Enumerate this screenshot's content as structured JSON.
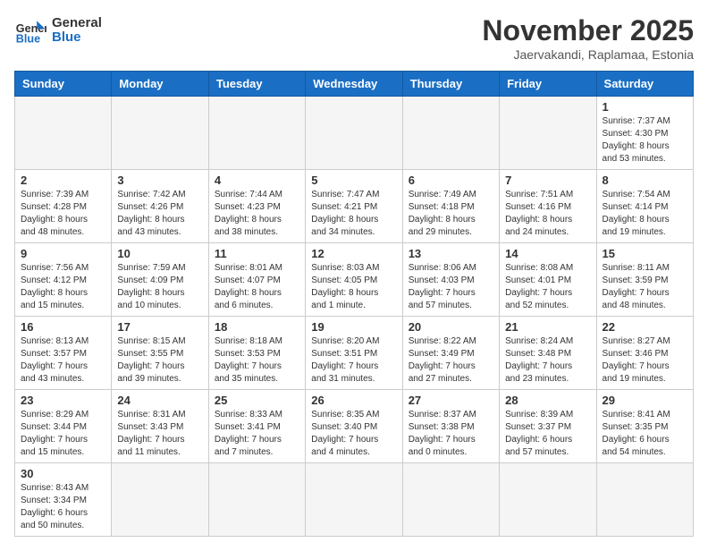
{
  "header": {
    "logo_general": "General",
    "logo_blue": "Blue",
    "month_title": "November 2025",
    "location": "Jaervakandi, Raplamaa, Estonia"
  },
  "days_of_week": [
    "Sunday",
    "Monday",
    "Tuesday",
    "Wednesday",
    "Thursday",
    "Friday",
    "Saturday"
  ],
  "weeks": [
    [
      {
        "day": "",
        "info": ""
      },
      {
        "day": "",
        "info": ""
      },
      {
        "day": "",
        "info": ""
      },
      {
        "day": "",
        "info": ""
      },
      {
        "day": "",
        "info": ""
      },
      {
        "day": "",
        "info": ""
      },
      {
        "day": "1",
        "info": "Sunrise: 7:37 AM\nSunset: 4:30 PM\nDaylight: 8 hours\nand 53 minutes."
      }
    ],
    [
      {
        "day": "2",
        "info": "Sunrise: 7:39 AM\nSunset: 4:28 PM\nDaylight: 8 hours\nand 48 minutes."
      },
      {
        "day": "3",
        "info": "Sunrise: 7:42 AM\nSunset: 4:26 PM\nDaylight: 8 hours\nand 43 minutes."
      },
      {
        "day": "4",
        "info": "Sunrise: 7:44 AM\nSunset: 4:23 PM\nDaylight: 8 hours\nand 38 minutes."
      },
      {
        "day": "5",
        "info": "Sunrise: 7:47 AM\nSunset: 4:21 PM\nDaylight: 8 hours\nand 34 minutes."
      },
      {
        "day": "6",
        "info": "Sunrise: 7:49 AM\nSunset: 4:18 PM\nDaylight: 8 hours\nand 29 minutes."
      },
      {
        "day": "7",
        "info": "Sunrise: 7:51 AM\nSunset: 4:16 PM\nDaylight: 8 hours\nand 24 minutes."
      },
      {
        "day": "8",
        "info": "Sunrise: 7:54 AM\nSunset: 4:14 PM\nDaylight: 8 hours\nand 19 minutes."
      }
    ],
    [
      {
        "day": "9",
        "info": "Sunrise: 7:56 AM\nSunset: 4:12 PM\nDaylight: 8 hours\nand 15 minutes."
      },
      {
        "day": "10",
        "info": "Sunrise: 7:59 AM\nSunset: 4:09 PM\nDaylight: 8 hours\nand 10 minutes."
      },
      {
        "day": "11",
        "info": "Sunrise: 8:01 AM\nSunset: 4:07 PM\nDaylight: 8 hours\nand 6 minutes."
      },
      {
        "day": "12",
        "info": "Sunrise: 8:03 AM\nSunset: 4:05 PM\nDaylight: 8 hours\nand 1 minute."
      },
      {
        "day": "13",
        "info": "Sunrise: 8:06 AM\nSunset: 4:03 PM\nDaylight: 7 hours\nand 57 minutes."
      },
      {
        "day": "14",
        "info": "Sunrise: 8:08 AM\nSunset: 4:01 PM\nDaylight: 7 hours\nand 52 minutes."
      },
      {
        "day": "15",
        "info": "Sunrise: 8:11 AM\nSunset: 3:59 PM\nDaylight: 7 hours\nand 48 minutes."
      }
    ],
    [
      {
        "day": "16",
        "info": "Sunrise: 8:13 AM\nSunset: 3:57 PM\nDaylight: 7 hours\nand 43 minutes."
      },
      {
        "day": "17",
        "info": "Sunrise: 8:15 AM\nSunset: 3:55 PM\nDaylight: 7 hours\nand 39 minutes."
      },
      {
        "day": "18",
        "info": "Sunrise: 8:18 AM\nSunset: 3:53 PM\nDaylight: 7 hours\nand 35 minutes."
      },
      {
        "day": "19",
        "info": "Sunrise: 8:20 AM\nSunset: 3:51 PM\nDaylight: 7 hours\nand 31 minutes."
      },
      {
        "day": "20",
        "info": "Sunrise: 8:22 AM\nSunset: 3:49 PM\nDaylight: 7 hours\nand 27 minutes."
      },
      {
        "day": "21",
        "info": "Sunrise: 8:24 AM\nSunset: 3:48 PM\nDaylight: 7 hours\nand 23 minutes."
      },
      {
        "day": "22",
        "info": "Sunrise: 8:27 AM\nSunset: 3:46 PM\nDaylight: 7 hours\nand 19 minutes."
      }
    ],
    [
      {
        "day": "23",
        "info": "Sunrise: 8:29 AM\nSunset: 3:44 PM\nDaylight: 7 hours\nand 15 minutes."
      },
      {
        "day": "24",
        "info": "Sunrise: 8:31 AM\nSunset: 3:43 PM\nDaylight: 7 hours\nand 11 minutes."
      },
      {
        "day": "25",
        "info": "Sunrise: 8:33 AM\nSunset: 3:41 PM\nDaylight: 7 hours\nand 7 minutes."
      },
      {
        "day": "26",
        "info": "Sunrise: 8:35 AM\nSunset: 3:40 PM\nDaylight: 7 hours\nand 4 minutes."
      },
      {
        "day": "27",
        "info": "Sunrise: 8:37 AM\nSunset: 3:38 PM\nDaylight: 7 hours\nand 0 minutes."
      },
      {
        "day": "28",
        "info": "Sunrise: 8:39 AM\nSunset: 3:37 PM\nDaylight: 6 hours\nand 57 minutes."
      },
      {
        "day": "29",
        "info": "Sunrise: 8:41 AM\nSunset: 3:35 PM\nDaylight: 6 hours\nand 54 minutes."
      }
    ],
    [
      {
        "day": "30",
        "info": "Sunrise: 8:43 AM\nSunset: 3:34 PM\nDaylight: 6 hours\nand 50 minutes."
      },
      {
        "day": "",
        "info": ""
      },
      {
        "day": "",
        "info": ""
      },
      {
        "day": "",
        "info": ""
      },
      {
        "day": "",
        "info": ""
      },
      {
        "day": "",
        "info": ""
      },
      {
        "day": "",
        "info": ""
      }
    ]
  ]
}
